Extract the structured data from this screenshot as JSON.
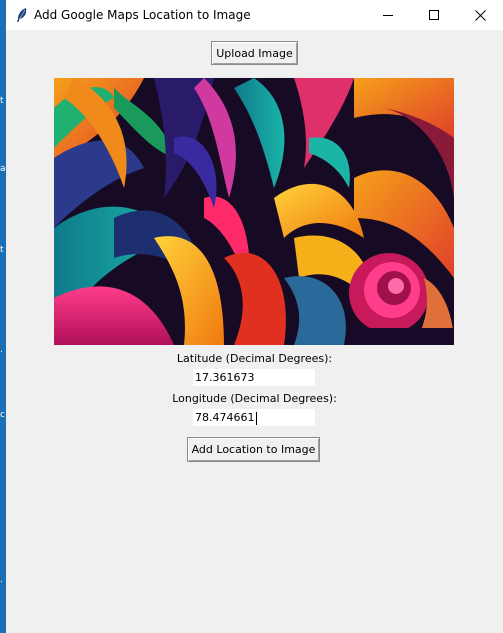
{
  "window": {
    "title": "Add Google Maps Location to Image"
  },
  "toolbar": {
    "upload_label": "Upload Image"
  },
  "form": {
    "latitude_label": "Latitude (Decimal Degrees):",
    "latitude_value": "17.361673",
    "longitude_label": "Longitude (Decimal Degrees):",
    "longitude_value": "78.474661",
    "submit_label": "Add Location to Image"
  },
  "background_strip": {
    "glyphs": [
      "t",
      "a",
      "t",
      ".",
      "c",
      "."
    ]
  },
  "icons": {
    "app": "feather-icon",
    "minimize": "minimize-icon",
    "maximize": "maximize-icon",
    "close": "close-icon"
  },
  "colors": {
    "window_bg": "#f0f0f0",
    "titlebar_bg": "#ffffff",
    "background_window": "#1a6fb5"
  }
}
